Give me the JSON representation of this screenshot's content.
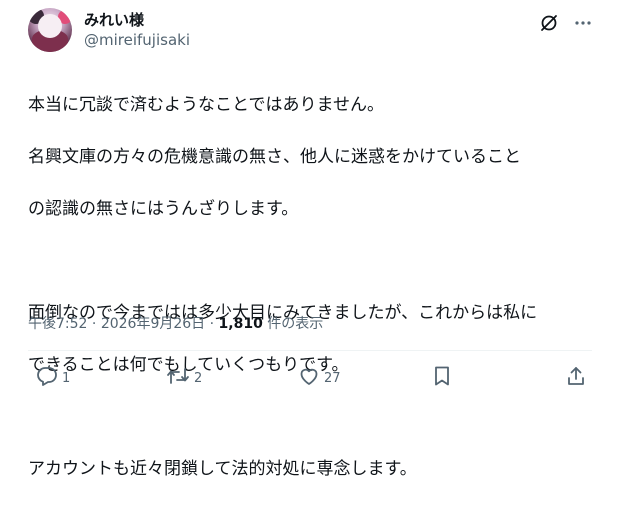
{
  "user": {
    "display_name": "みれい様",
    "handle": "@mireifujisaki"
  },
  "post": {
    "lines": [
      "本当に冗談で済むようなことではありません。",
      "名興文庫の方々の危機意識の無さ、他人に迷惑をかけていること",
      "の認識の無さにはうんざりします。",
      "",
      "面倒なので今まではは多少大目にみてきましたが、これからは私に",
      "できることは何でもしていくつもりです。",
      "",
      "アカウントも近々閉鎖して法的対処に専念します。"
    ],
    "time": "午後7:52",
    "separator": "·",
    "date": "2026年9月26日",
    "views_count": "1,810",
    "views_label": "件の表示"
  },
  "actions": {
    "reply_count": "1",
    "retweet_count": "2",
    "like_count": "27"
  },
  "icons": {
    "grok": "grok-icon",
    "more": "more-icon",
    "reply": "reply-icon",
    "retweet": "retweet-icon",
    "like": "heart-icon",
    "bookmark": "bookmark-icon",
    "share": "share-icon"
  },
  "colors": {
    "text": "#0f1419",
    "secondary": "#536471",
    "divider": "#eff3f4"
  }
}
